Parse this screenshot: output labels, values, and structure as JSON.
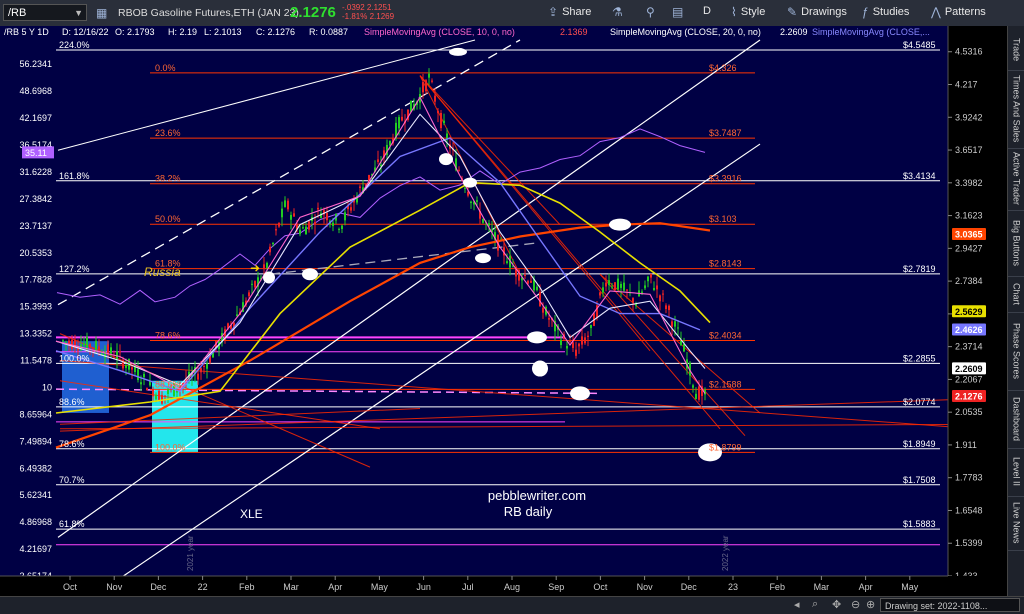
{
  "toolbar": {
    "symbol": "/RB",
    "instrument_name": "RBOB Gasoline Futures,ETH (JAN 23)",
    "last_price": "2.1276",
    "change_top": "-.0392",
    "change_pct": "-1.81%",
    "bid_top": "2.1251",
    "bid_bottom": "2.1269",
    "share_label": "Share",
    "timeframe_label": "D",
    "style_label": "Style",
    "drawings_label": "Drawings",
    "studies_label": "Studies",
    "patterns_label": "Patterns",
    "icons": [
      "share-icon",
      "flask-icon",
      "pin-icon",
      "calendar-icon",
      "style-icon",
      "drawings-icon",
      "studies-icon",
      "patterns-icon"
    ]
  },
  "info_line": {
    "symbol_period": "/RB 5 Y 1D",
    "date": "D: 12/16/22",
    "open": "O: 2.1793",
    "high": "H: 2.19",
    "low": "L: 2.1013",
    "close": "C: 2.1276",
    "range": "R: 0.0887",
    "sma10": "SimpleMovingAvg (CLOSE, 10, 0, no)",
    "sma10_value": "2.1369",
    "sma20": "SimpleMovingAvg (CLOSE, 20, 0, no)",
    "sma20_value": "2.2609",
    "sma_other": "SimpleMovingAvg (CLOSE,..."
  },
  "annotations": {
    "russia": "Russia",
    "xle": "XLE",
    "watermark_1": "pebblewriter.com",
    "watermark_2": "RB daily",
    "year_2021": "2021 year",
    "year_2022": "2022 year"
  },
  "colors": {
    "background": "#000044",
    "bull_candle": "#22cc22",
    "bear_candle": "#ee2222",
    "sma10": "#ff66cc",
    "sma20": "#e8e8ff",
    "sma50": "#7777ff",
    "sma100": "#e8e000",
    "sma200": "#ff4400",
    "xle": "#b060ff",
    "fib_left": "#ff44ff",
    "fib_right": "#ff3300",
    "channel": "#ffffff"
  },
  "right_axis": {
    "ticks": [
      "4.5316",
      "4.217",
      "3.9242",
      "3.6517",
      "3.3982",
      "3.1623",
      "2.9427",
      "2.7384",
      "2.5482",
      "2.3714",
      "2.2067",
      "2.0535",
      "1.911",
      "1.7783",
      "1.6548",
      "1.5399",
      "1.433"
    ],
    "badges": [
      {
        "label": "3.0365",
        "color": "#ff4400",
        "text_color": "#ffffff"
      },
      {
        "label": "2.5629",
        "color": "#e8e000",
        "text_color": "#000000"
      },
      {
        "label": "2.4626",
        "color": "#7777ff",
        "text_color": "#ffffff"
      },
      {
        "label": "2.2609",
        "color": "#ffffff",
        "text_color": "#000000"
      },
      {
        "label": "2.1276",
        "color": "#ee2222",
        "text_color": "#ffffff"
      }
    ]
  },
  "left_axis": {
    "ticks": [
      "56.2341",
      "48.6968",
      "42.1697",
      "36.5174",
      "31.6228",
      "27.3842",
      "23.7137",
      "20.5353",
      "17.7828",
      "15.3993",
      "13.3352",
      "11.5478",
      "10",
      "8.65964",
      "7.49894",
      "6.49382",
      "5.62341",
      "4.86968",
      "4.21697",
      "3.65174"
    ],
    "badge": {
      "label": "35.11",
      "color": "#b060ff"
    }
  },
  "x_axis": {
    "labels": [
      "Oct",
      "Nov",
      "Dec",
      "22",
      "Feb",
      "Mar",
      "Apr",
      "May",
      "Jun",
      "Jul",
      "Aug",
      "Sep",
      "Oct",
      "Nov",
      "Dec",
      "23",
      "Feb",
      "Mar",
      "Apr",
      "May"
    ]
  },
  "fib_left_labels": [
    "224.0%",
    "161.8%",
    "127.2%",
    "100.0%",
    "88.6%",
    "78.6%",
    "70.7%",
    "61.8%"
  ],
  "fib_left_values": [
    "$4.5485",
    "$3.4134",
    "$2.7819",
    "$2.2855",
    "$2.0774",
    "$1.8949",
    "$1.7508",
    "$1.5883"
  ],
  "fib_right_labels": [
    "0.0%",
    "23.6%",
    "38.2%",
    "50.0%",
    "61.8%",
    "78.6%",
    "88.6%",
    "100.0%"
  ],
  "fib_right_values": [
    "$4.326",
    "$3.7487",
    "$3.3916",
    "$3.103",
    "$2.8143",
    "$2.4034",
    "$2.1588",
    "$1.8799"
  ],
  "sidebar_tabs": [
    "Trade",
    "Times And Sales",
    "Active Trader",
    "Big Buttons",
    "Chart",
    "Phase Scores",
    "Dashboard",
    "Level II",
    "Live News"
  ],
  "bottom": {
    "drawing_set": "Drawing set: 2022-1108...",
    "icons": [
      "scroll-left-icon",
      "zoom-icon",
      "drag-icon",
      "zoom-out-icon",
      "zoom-in-icon",
      "fullscreen-icon"
    ]
  },
  "chart_data": {
    "type": "candlestick",
    "title": "",
    "xlabel": "",
    "ylabel": "",
    "right_axis_scale": "log",
    "ylim": [
      1.433,
      4.65
    ],
    "left_ylim": [
      3.65174,
      64.0
    ],
    "grid": false,
    "period": "daily",
    "x_range": [
      "2021-10",
      "2023-05"
    ],
    "ohlc_last": {
      "open": 2.1793,
      "high": 2.19,
      "low": 2.1013,
      "close": 2.1276
    },
    "price_path": [
      {
        "x": "2021-10",
        "y": 2.4
      },
      {
        "x": "2021-11",
        "y": 2.3
      },
      {
        "x": "2021-12",
        "y": 2.18
      },
      {
        "x": "2022-01",
        "y": 2.35
      },
      {
        "x": "2022-02",
        "y": 2.75
      },
      {
        "x": "2022-03",
        "y": 3.25
      },
      {
        "x": "2022-04",
        "y": 3.3
      },
      {
        "x": "2022-05",
        "y": 3.9
      },
      {
        "x": "2022-06",
        "y": 4.28
      },
      {
        "x": "2022-07",
        "y": 3.35
      },
      {
        "x": "2022-08",
        "y": 2.78
      },
      {
        "x": "2022-09",
        "y": 2.4
      },
      {
        "x": "2022-10",
        "y": 2.7
      },
      {
        "x": "2022-11",
        "y": 2.6
      },
      {
        "x": "2022-12",
        "y": 2.13
      }
    ],
    "series": [
      {
        "name": "SimpleMovingAvg (CLOSE, 10, 0, no)",
        "last": 2.1369
      },
      {
        "name": "SimpleMovingAvg (CLOSE, 20, 0, no)",
        "last": 2.2609
      },
      {
        "name": "SimpleMovingAvg (CLOSE,...",
        "last": 2.4626
      },
      {
        "name": "XLE",
        "last": 35.11
      }
    ]
  }
}
